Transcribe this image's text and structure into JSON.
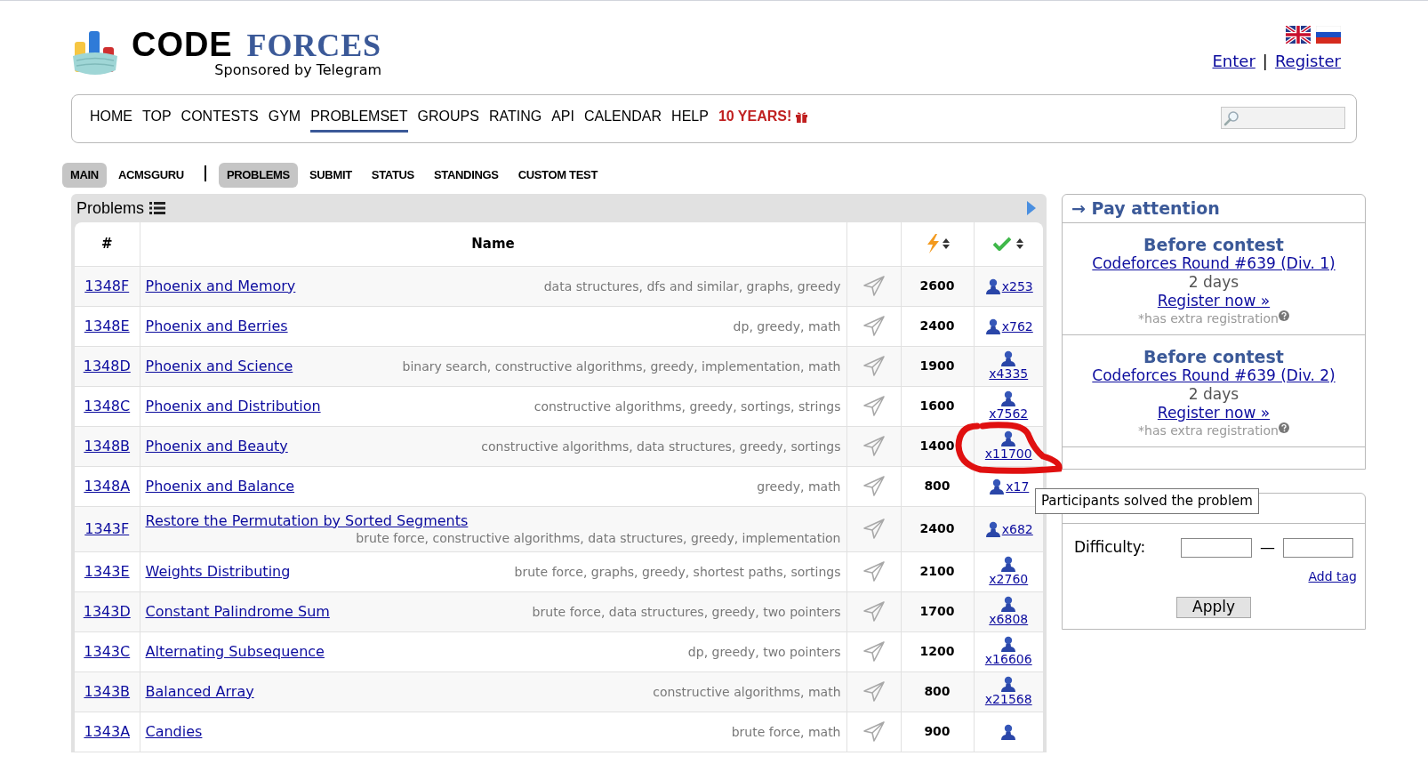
{
  "logo": {
    "word1": "CODE",
    "word2": "FORCES",
    "sponsor": "Sponsored by Telegram"
  },
  "auth": {
    "enter": "Enter",
    "separator": "|",
    "register": "Register"
  },
  "nav": [
    {
      "label": "HOME",
      "selected": false,
      "kind": "plain"
    },
    {
      "label": "TOP",
      "selected": false,
      "kind": "plain"
    },
    {
      "label": "CONTESTS",
      "selected": false,
      "kind": "plain"
    },
    {
      "label": "GYM",
      "selected": false,
      "kind": "plain"
    },
    {
      "label": "PROBLEMSET",
      "selected": true,
      "kind": "plain"
    },
    {
      "label": "GROUPS",
      "selected": false,
      "kind": "plain"
    },
    {
      "label": "RATING",
      "selected": false,
      "kind": "plain"
    },
    {
      "label": "API",
      "selected": false,
      "kind": "plain"
    },
    {
      "label": "CALENDAR",
      "selected": false,
      "kind": "plain"
    },
    {
      "label": "HELP",
      "selected": false,
      "kind": "plain"
    },
    {
      "label": "10 YEARS!",
      "selected": false,
      "kind": "highlight"
    }
  ],
  "subnav": [
    {
      "kind": "tab",
      "label": "MAIN",
      "selected": true
    },
    {
      "kind": "tab",
      "label": "ACMSGURU",
      "selected": false
    },
    {
      "kind": "separator"
    },
    {
      "kind": "tab",
      "label": "PROBLEMS",
      "selected": true
    },
    {
      "kind": "tab",
      "label": "SUBMIT",
      "selected": false
    },
    {
      "kind": "tab",
      "label": "STATUS",
      "selected": false
    },
    {
      "kind": "tab",
      "label": "STANDINGS",
      "selected": false
    },
    {
      "kind": "tab",
      "label": "CUSTOM TEST",
      "selected": false
    }
  ],
  "problems": {
    "title": "Problems",
    "columns": [
      "#",
      "Name"
    ],
    "rows": [
      {
        "id": "1348F",
        "name": "Phoenix and Memory",
        "tags": "data structures, dfs and similar, graphs, greedy",
        "rating": "2600",
        "solved": "x253"
      },
      {
        "id": "1348E",
        "name": "Phoenix and Berries",
        "tags": "dp, greedy, math",
        "rating": "2400",
        "solved": "x762"
      },
      {
        "id": "1348D",
        "name": "Phoenix and Science",
        "tags": "binary search, constructive algorithms, greedy, implementation, math",
        "rating": "1900",
        "solved": "x4335"
      },
      {
        "id": "1348C",
        "name": "Phoenix and Distribution",
        "tags": "constructive algorithms, greedy, sortings, strings",
        "rating": "1600",
        "solved": "x7562"
      },
      {
        "id": "1348B",
        "name": "Phoenix and Beauty",
        "tags": "constructive algorithms, data structures, greedy, sortings",
        "rating": "1400",
        "solved": "x11700"
      },
      {
        "id": "1348A",
        "name": "Phoenix and Balance",
        "tags": "greedy, math",
        "rating": "800",
        "solved": "x17"
      },
      {
        "id": "1343F",
        "name": "Restore the Permutation by Sorted Segments",
        "tags": "brute force, constructive algorithms, data structures, greedy, implementation",
        "rating": "2400",
        "solved": "x682"
      },
      {
        "id": "1343E",
        "name": "Weights Distributing",
        "tags": "brute force, graphs, greedy, shortest paths, sortings",
        "rating": "2100",
        "solved": "x2760"
      },
      {
        "id": "1343D",
        "name": "Constant Palindrome Sum",
        "tags": "brute force, data structures, greedy, two pointers",
        "rating": "1700",
        "solved": "x6808"
      },
      {
        "id": "1343C",
        "name": "Alternating Subsequence",
        "tags": "dp, greedy, two pointers",
        "rating": "1200",
        "solved": "x16606"
      },
      {
        "id": "1343B",
        "name": "Balanced Array",
        "tags": "constructive algorithms, math",
        "rating": "800",
        "solved": "x21568"
      },
      {
        "id": "1343A",
        "name": "Candies",
        "tags": "brute force, math",
        "rating": "900"
      }
    ]
  },
  "pay_attention": {
    "title": "→ Pay attention",
    "contests": [
      {
        "heading": "Before contest",
        "name": "Codeforces Round #639 (Div. 1)",
        "time": "2 days",
        "register": "Register now »",
        "note": "*has extra registration"
      },
      {
        "heading": "Before contest",
        "name": "Codeforces Round #639 (Div. 2)",
        "time": "2 days",
        "register": "Register now »",
        "note": "*has extra registration"
      }
    ]
  },
  "filter": {
    "difficulty_label": "Difficulty:",
    "dash": "—",
    "add_tag": "Add tag",
    "apply": "Apply"
  },
  "tooltip": "Participants solved the problem"
}
